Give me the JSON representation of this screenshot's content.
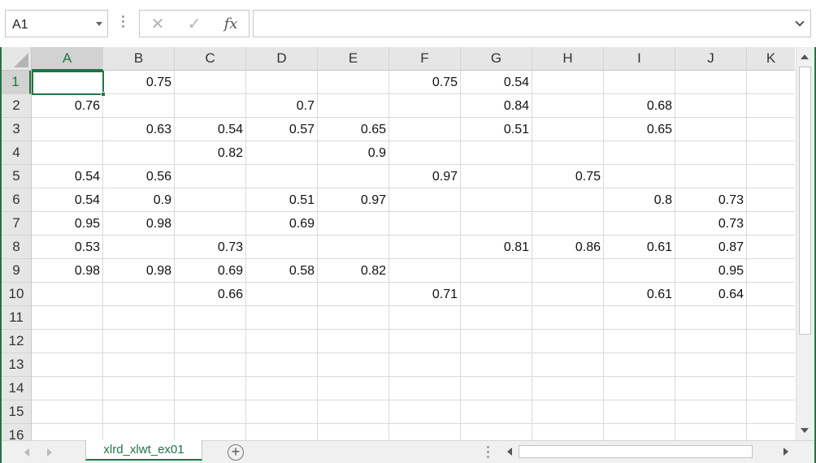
{
  "formula_bar": {
    "name_box": "A1",
    "cancel_icon": "x-icon",
    "enter_icon": "check-icon",
    "fx_label": "fx",
    "formula_value": ""
  },
  "columns": [
    "A",
    "B",
    "C",
    "D",
    "E",
    "F",
    "G",
    "H",
    "I",
    "J",
    "K"
  ],
  "rows": [
    "1",
    "2",
    "3",
    "4",
    "5",
    "6",
    "7",
    "8",
    "9",
    "10",
    "11",
    "12",
    "13",
    "14",
    "15",
    "16"
  ],
  "active_cell": "A1",
  "cells": [
    [
      "",
      "0.75",
      "",
      "",
      "",
      "0.75",
      "0.54",
      "",
      "",
      "",
      ""
    ],
    [
      "0.76",
      "",
      "",
      "0.7",
      "",
      "",
      "0.84",
      "",
      "0.68",
      "",
      ""
    ],
    [
      "",
      "0.63",
      "0.54",
      "0.57",
      "0.65",
      "",
      "0.51",
      "",
      "0.65",
      "",
      ""
    ],
    [
      "",
      "",
      "0.82",
      "",
      "0.9",
      "",
      "",
      "",
      "",
      "",
      ""
    ],
    [
      "0.54",
      "0.56",
      "",
      "",
      "",
      "0.97",
      "",
      "0.75",
      "",
      "",
      ""
    ],
    [
      "0.54",
      "0.9",
      "",
      "0.51",
      "0.97",
      "",
      "",
      "",
      "0.8",
      "0.73",
      ""
    ],
    [
      "0.95",
      "0.98",
      "",
      "0.69",
      "",
      "",
      "",
      "",
      "",
      "0.73",
      ""
    ],
    [
      "0.53",
      "",
      "0.73",
      "",
      "",
      "",
      "0.81",
      "0.86",
      "0.61",
      "0.87",
      ""
    ],
    [
      "0.98",
      "0.98",
      "0.69",
      "0.58",
      "0.82",
      "",
      "",
      "",
      "",
      "0.95",
      ""
    ],
    [
      "",
      "",
      "0.66",
      "",
      "",
      "0.71",
      "",
      "",
      "0.61",
      "0.64",
      ""
    ],
    [
      "",
      "",
      "",
      "",
      "",
      "",
      "",
      "",
      "",
      "",
      ""
    ],
    [
      "",
      "",
      "",
      "",
      "",
      "",
      "",
      "",
      "",
      "",
      ""
    ],
    [
      "",
      "",
      "",
      "",
      "",
      "",
      "",
      "",
      "",
      "",
      ""
    ],
    [
      "",
      "",
      "",
      "",
      "",
      "",
      "",
      "",
      "",
      "",
      ""
    ],
    [
      "",
      "",
      "",
      "",
      "",
      "",
      "",
      "",
      "",
      "",
      ""
    ],
    [
      "",
      "",
      "",
      "",
      "",
      "",
      "",
      "",
      "",
      "",
      ""
    ]
  ],
  "sheets": [
    {
      "name": "xlrd_xlwt_ex01",
      "active": true
    }
  ],
  "colors": {
    "accent": "#217346",
    "header_bg": "#e6e6e6",
    "gridline": "#dadada"
  }
}
